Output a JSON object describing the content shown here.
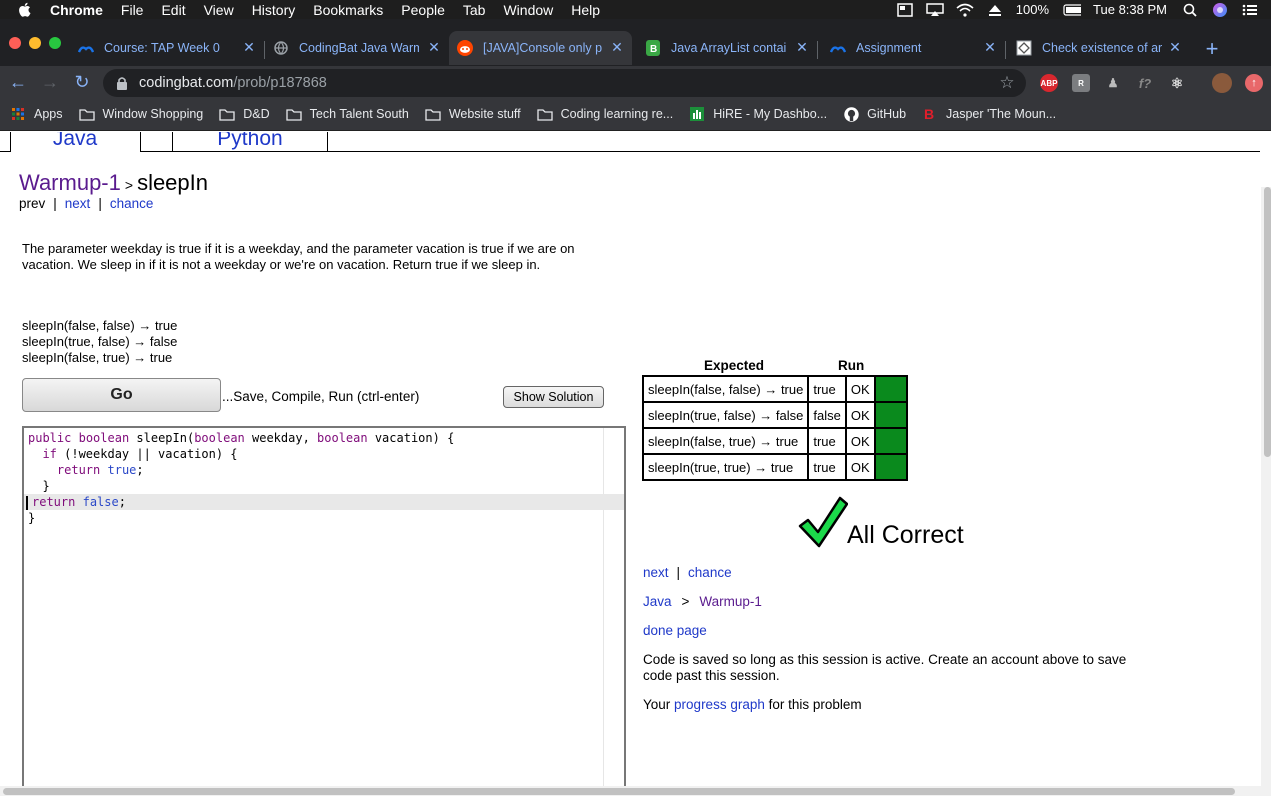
{
  "menubar": {
    "items": [
      "Chrome",
      "File",
      "Edit",
      "View",
      "History",
      "Bookmarks",
      "People",
      "Tab",
      "Window",
      "Help"
    ],
    "battery": "100%",
    "clock": "Tue 8:38 PM"
  },
  "tabs": [
    {
      "title": "Course: TAP Week 0",
      "icon": "moodle-icon"
    },
    {
      "title": "CodingBat Java Warm",
      "icon": "globe-icon"
    },
    {
      "title": "[JAVA]Console only p",
      "icon": "reddit-icon"
    },
    {
      "title": "Java ArrayList contai",
      "icon": "b-icon"
    },
    {
      "title": "Assignment",
      "icon": "moodle-icon"
    },
    {
      "title": "Check existence of ar",
      "icon": "site-icon"
    }
  ],
  "address": {
    "host": "codingbat.com",
    "path": "/prob/p187868"
  },
  "bookmarks": [
    {
      "label": "Apps",
      "icon": "apps-grid-icon"
    },
    {
      "label": "Window Shopping",
      "icon": "folder-icon"
    },
    {
      "label": "D&D",
      "icon": "folder-icon"
    },
    {
      "label": "Tech Talent South",
      "icon": "folder-icon"
    },
    {
      "label": "Website stuff",
      "icon": "folder-icon"
    },
    {
      "label": "Coding learning re...",
      "icon": "folder-icon"
    },
    {
      "label": "HiRE - My Dashbo...",
      "icon": "hire-icon"
    },
    {
      "label": "GitHub",
      "icon": "github-icon"
    },
    {
      "label": "Jasper 'The Moun...",
      "icon": "b-logo-icon"
    }
  ],
  "lang_tabs": [
    "Java",
    "Python"
  ],
  "breadcrumb": {
    "section": "Warmup-1",
    "sep": ">",
    "problem": "sleepIn"
  },
  "problem_nav": {
    "prev": "prev",
    "next": "next",
    "chance": "chance",
    "sep": "|"
  },
  "description": "The parameter weekday is true if it is a weekday, and the parameter vacation is true if we are on vacation. We sleep in if it is not a weekday or we're on vacation. Return true if we sleep in.",
  "examples": [
    "sleepIn(false, false) → true",
    "sleepIn(true, false) → false",
    "sleepIn(false, true) → true"
  ],
  "go_button": "Go",
  "go_hint": "...Save, Compile, Run (ctrl-enter)",
  "show_solution": "Show Solution",
  "results": {
    "header_expected": "Expected",
    "header_run": "Run",
    "rows": [
      {
        "expected": "sleepIn(false, false) → true",
        "run": "true",
        "status": "OK"
      },
      {
        "expected": "sleepIn(true, false) → false",
        "run": "false",
        "status": "OK"
      },
      {
        "expected": "sleepIn(false, true) → true",
        "run": "true",
        "status": "OK"
      },
      {
        "expected": "sleepIn(true, true) → true",
        "run": "true",
        "status": "OK"
      }
    ],
    "summary": "All Correct"
  },
  "after_links": {
    "next": "next",
    "chance": "chance",
    "sep": "|"
  },
  "lower_crumb": {
    "lang": "Java",
    "sep": ">",
    "section": "Warmup-1"
  },
  "done_page": "done page",
  "saved_note": "Code is saved so long as this session is active. Create an account above to save code past this session.",
  "progress": {
    "before": "Your",
    "link": "progress graph",
    "after": "for this problem"
  },
  "colors": {
    "pass": "#0a8a1d",
    "link": "#1f39c9",
    "visited": "#5a1b8e"
  }
}
